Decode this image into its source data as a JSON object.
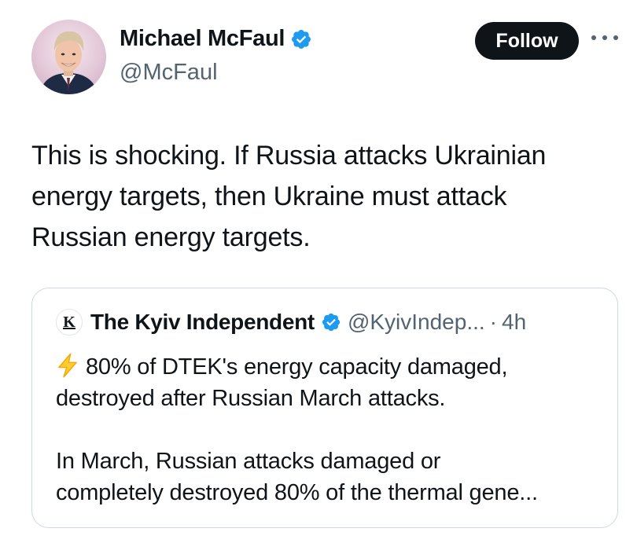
{
  "tweet": {
    "author": {
      "name": "Michael McFaul",
      "handle": "@McFaul",
      "avatar": "profile-photo"
    },
    "follow_label": "Follow",
    "more_icon": "more-horizontal-icon",
    "text_lines": [
      "This is shocking. If Russia attacks Ukrainian",
      "energy targets, then Ukraine must attack",
      "Russian energy targets."
    ]
  },
  "quote": {
    "logo_letter": "K",
    "name": "The Kyiv Independent",
    "handle": "@KyivIndep...",
    "separator": "·",
    "time": "4h",
    "first_line_rest": "80% of DTEK's energy capacity damaged,",
    "lines": [
      "destroyed after Russian March attacks.",
      "",
      "In March, Russian attacks damaged or",
      "completely destroyed 80% of the thermal gene..."
    ],
    "bolt_icon": "high-voltage-emoji"
  },
  "colors": {
    "verified_blue": "#1d9bf0",
    "text_primary": "#0f1419",
    "text_secondary": "#536471",
    "border": "#cfd9de",
    "bolt_yellow": "#ffcc33"
  }
}
